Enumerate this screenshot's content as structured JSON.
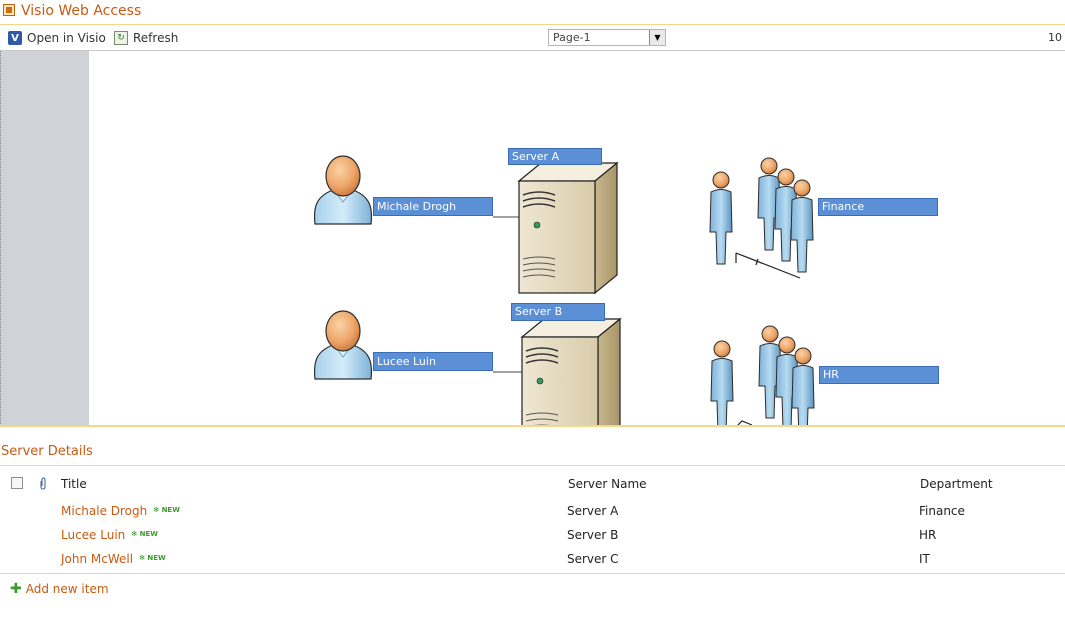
{
  "webpart": {
    "title": "Visio Web Access"
  },
  "toolbar": {
    "open_label": "Open in Visio",
    "refresh_label": "Refresh",
    "page_select": "Page-1",
    "zoom_text": "10"
  },
  "diagram": {
    "people": [
      {
        "label": "Michale Drogh"
      },
      {
        "label": "Lucee Luin"
      }
    ],
    "servers": [
      {
        "label": "Server A"
      },
      {
        "label": "Server B"
      }
    ],
    "departments": [
      {
        "label": "Finance"
      },
      {
        "label": "HR"
      }
    ]
  },
  "list": {
    "title": "Server Details",
    "columns": {
      "title": "Title",
      "server": "Server Name",
      "department": "Department"
    },
    "new_badge": "NEW",
    "rows": [
      {
        "title": "Michale Drogh",
        "server": "Server A",
        "department": "Finance"
      },
      {
        "title": "Lucee Luin",
        "server": "Server B",
        "department": "HR"
      },
      {
        "title": "John McWell",
        "server": "Server C",
        "department": "IT"
      }
    ],
    "add_new": "Add new item"
  },
  "colors": {
    "accent": "#c85a12",
    "label_blue": "#5b8fd6",
    "new_green": "#3d9a2f"
  }
}
